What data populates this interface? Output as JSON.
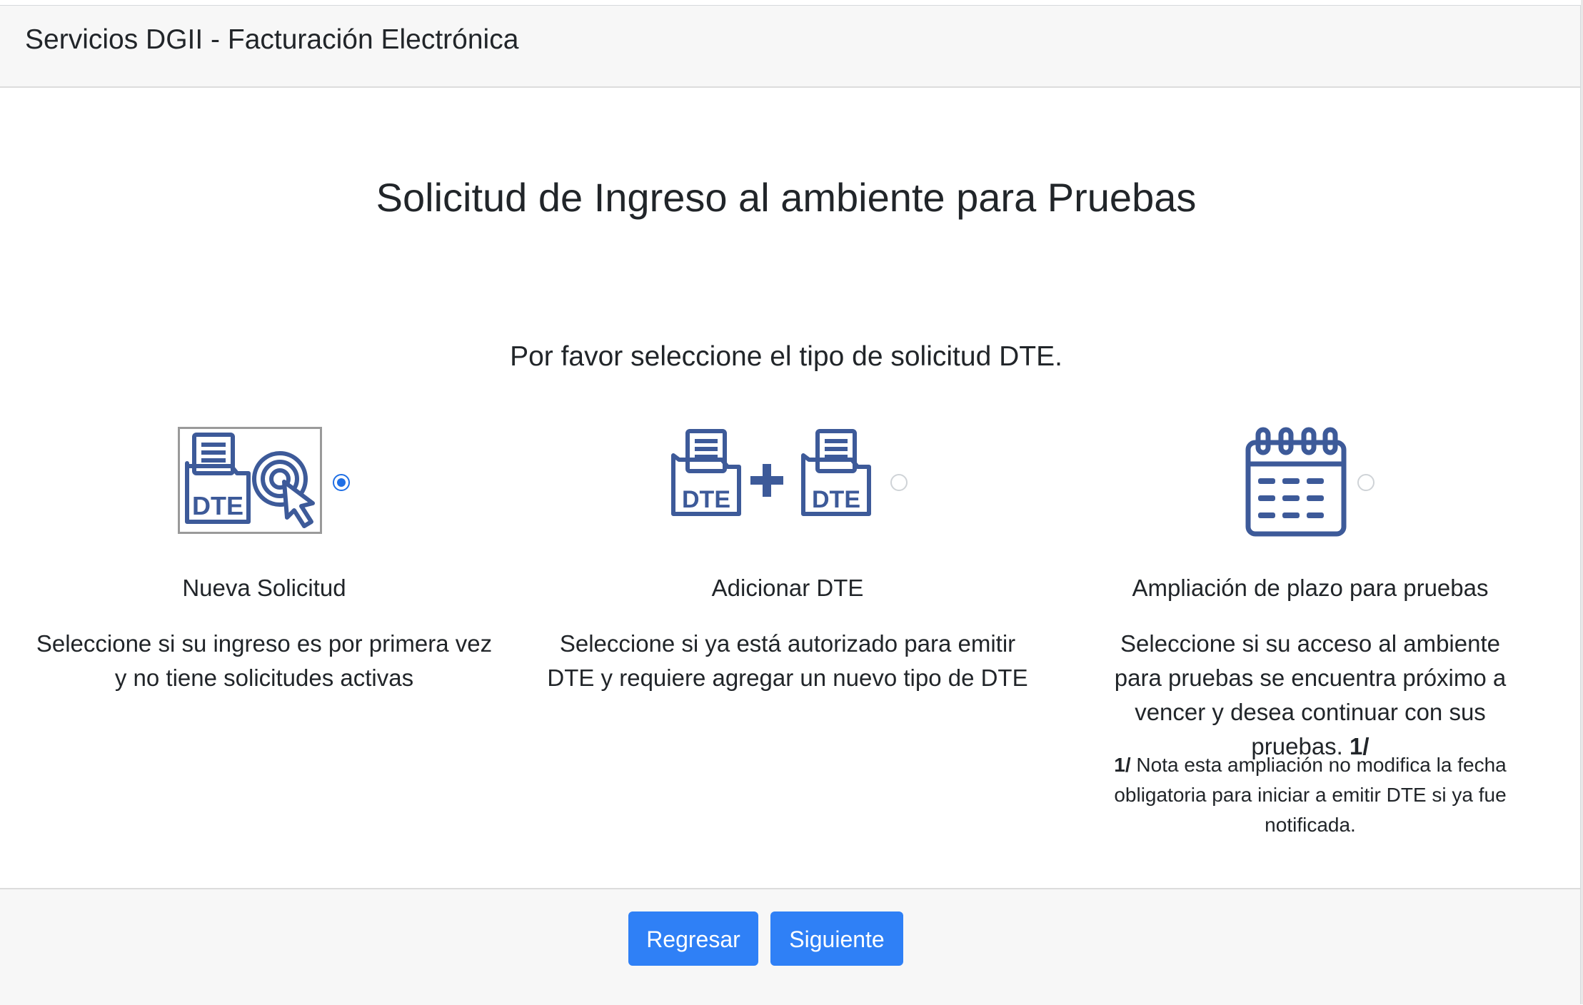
{
  "header": {
    "title": "Servicios DGII - Facturación Electrónica"
  },
  "page": {
    "title": "Solicitud de Ingreso al ambiente para Pruebas",
    "subtitle": "Por favor seleccione el tipo de solicitud DTE."
  },
  "icons": {
    "dte_text": "DTE"
  },
  "options": [
    {
      "label": "Nueva Solicitud",
      "description": "Seleccione si su ingreso es por primera vez y no tiene solicitudes activas",
      "selected": true,
      "icons": [
        "dte-document-icon",
        "target-cursor-icon"
      ]
    },
    {
      "label": "Adicionar DTE",
      "description": "Seleccione si ya está autorizado para emitir DTE y requiere agregar un nuevo tipo de DTE",
      "selected": false,
      "icons": [
        "dte-document-icon",
        "plus-icon",
        "dte-document-icon"
      ]
    },
    {
      "label": "Ampliación de plazo para pruebas",
      "description": "Seleccione si su acceso al ambiente para pruebas se encuentra próximo a vencer y desea continuar con sus pruebas.",
      "footnote_ref": "1/",
      "note_ref": "1/",
      "note": "Nota esta ampliación no modifica la fecha obligatoria para iniciar a emitir DTE si ya fue notificada.",
      "selected": false,
      "icons": [
        "calendar-icon"
      ]
    }
  ],
  "footer": {
    "back_label": "Regresar",
    "next_label": "Siguiente"
  },
  "colors": {
    "accent": "#2f80f6",
    "icon": "#3d5a99",
    "header_bg": "#f7f7f7",
    "radio_selected": "#1f6fe5"
  }
}
